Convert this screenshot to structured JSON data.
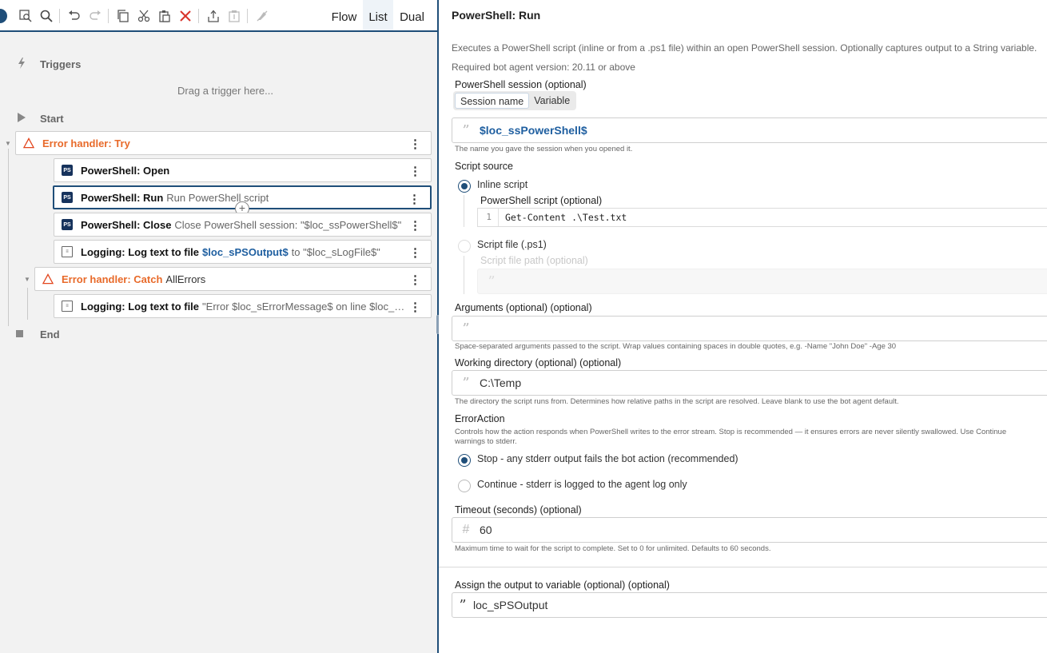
{
  "toolbar": {
    "view_tabs": [
      "Flow",
      "List",
      "Dual"
    ],
    "active_view": "List"
  },
  "flow": {
    "triggers_label": "Triggers",
    "drag_hint": "Drag a trigger here...",
    "start_label": "Start",
    "end_label": "End",
    "try_title": "Error handler: Try",
    "items": [
      {
        "title": "PowerShell: Open",
        "desc": ""
      },
      {
        "title": "PowerShell: Run",
        "desc": "Run PowerShell script"
      },
      {
        "title": "PowerShell: Close",
        "desc": "Close PowerShell session: \"$loc_ssPowerShell$\""
      },
      {
        "title": "Logging: Log text to file",
        "var": "$loc_sPSOutput$",
        "desc": "to \"$loc_sLogFile$\""
      }
    ],
    "catch_title": "Error handler: Catch",
    "catch_desc": "AllErrors",
    "catch_item": {
      "title": "Logging: Log text to file",
      "desc": "\"Error $loc_sErrorMessage$ on line $loc_sErrorLine$\""
    }
  },
  "panel": {
    "title": "PowerShell: Run",
    "description": "Executes a PowerShell script (inline or from a .ps1 file) within an open PowerShell session. Optionally captures output to a String variable.",
    "version": "Required bot agent version: 20.11 or above",
    "session_label": "PowerShell session (optional)",
    "session_options": [
      "Session name",
      "Variable"
    ],
    "session_value": "$loc_ssPowerShell$",
    "session_hint": "The name you gave the session when you opened it.",
    "script_source_label": "Script source",
    "inline_label": "Inline script",
    "script_label": "PowerShell script (optional)",
    "script_line_no": "1",
    "script_code": "Get-Content .\\Test.txt",
    "file_label": "Script file (.ps1)",
    "file_path_label": "Script file path (optional)",
    "arguments_label": "Arguments (optional) (optional)",
    "arguments_hint": "Space-separated arguments passed to the script. Wrap values containing spaces in double quotes, e.g. -Name \"John Doe\" -Age 30",
    "workdir_label": "Working directory (optional) (optional)",
    "workdir_value": "C:\\Temp",
    "workdir_hint": "The directory the script runs from. Determines how relative paths in the script are resolved. Leave blank to use the bot agent default.",
    "erroraction_label": "ErrorAction",
    "erroraction_hint_1": "Controls how the action responds when PowerShell writes to the error stream. Stop is recommended — it ensures errors are never silently swallowed. Use Continue",
    "erroraction_hint_2": "warnings to stderr.",
    "stop_label": "Stop - any stderr output fails the bot action (recommended)",
    "continue_label": "Continue - stderr is logged to the agent log only",
    "timeout_label": "Timeout (seconds) (optional)",
    "timeout_value": "60",
    "timeout_hint": "Maximum time to wait for the script to complete. Set to 0 for unlimited. Defaults to 60 seconds.",
    "output_label": "Assign the output to variable (optional) (optional)",
    "output_value": "loc_sPSOutput"
  },
  "icons": {
    "quote": "”",
    "hash": "#",
    "kebab": "⋮"
  }
}
